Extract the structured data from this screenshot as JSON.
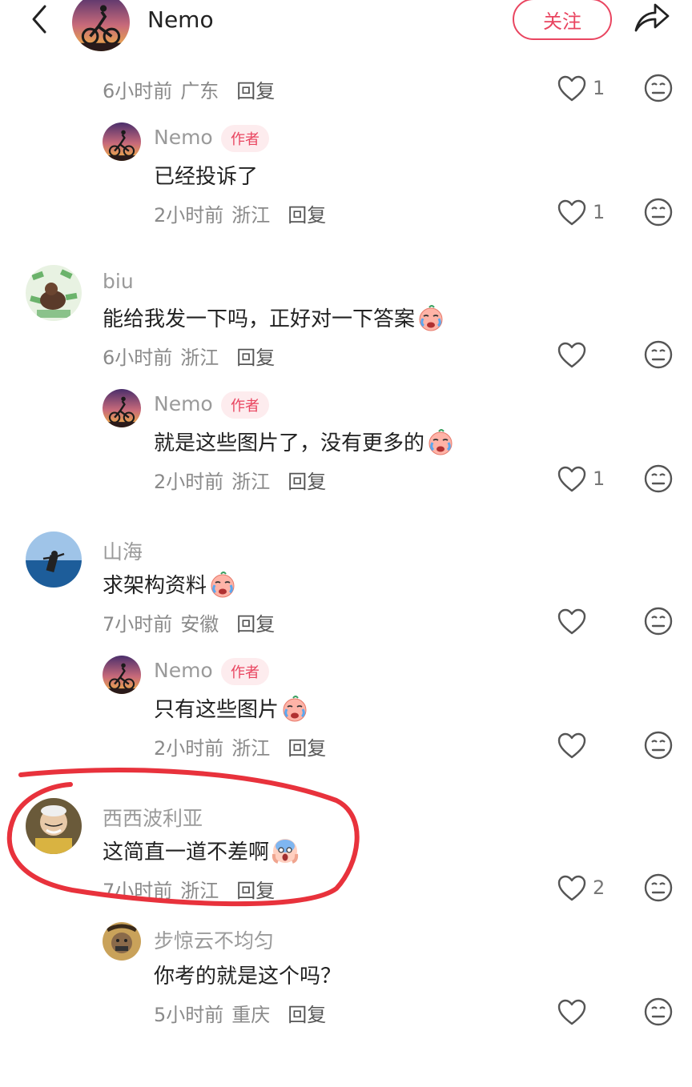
{
  "header": {
    "username": "Nemo",
    "follow_label": "关注"
  },
  "top_partial": {
    "time": "6小时前",
    "location": "广东",
    "reply_label": "回复",
    "like_count": "1"
  },
  "threads": [
    {
      "username": "Nemo",
      "badge": "作者",
      "text": "已经投诉了",
      "time": "2小时前",
      "location": "浙江",
      "reply_label": "回复",
      "like_count": "1"
    },
    {
      "username": "biu",
      "text": "能给我发一下吗，正好对一下答案",
      "time": "6小时前",
      "location": "浙江",
      "reply_label": "回复",
      "like_count": ""
    },
    {
      "username": "Nemo",
      "badge": "作者",
      "text": "就是这些图片了，没有更多的",
      "time": "2小时前",
      "location": "浙江",
      "reply_label": "回复",
      "like_count": "1"
    },
    {
      "username": "山海",
      "text": "求架构资料",
      "time": "7小时前",
      "location": "安徽",
      "reply_label": "回复",
      "like_count": ""
    },
    {
      "username": "Nemo",
      "badge": "作者",
      "text": "只有这些图片",
      "time": "2小时前",
      "location": "浙江",
      "reply_label": "回复",
      "like_count": ""
    },
    {
      "username": "西西波利亚",
      "text": "这简直一道不差啊",
      "time": "7小时前",
      "location": "浙江",
      "reply_label": "回复",
      "like_count": "2"
    },
    {
      "username": "步惊云不均匀",
      "text": "你考的就是这个吗？",
      "time": "5小时前",
      "location": "重庆",
      "reply_label": "回复",
      "like_count": ""
    }
  ],
  "colors": {
    "accent": "#e94560",
    "annotation_red": "#e8323c"
  },
  "icons": [
    "back-arrow-icon",
    "share-icon",
    "heart-icon",
    "dislike-face-icon",
    "crying-emoji",
    "shocked-emoji"
  ]
}
